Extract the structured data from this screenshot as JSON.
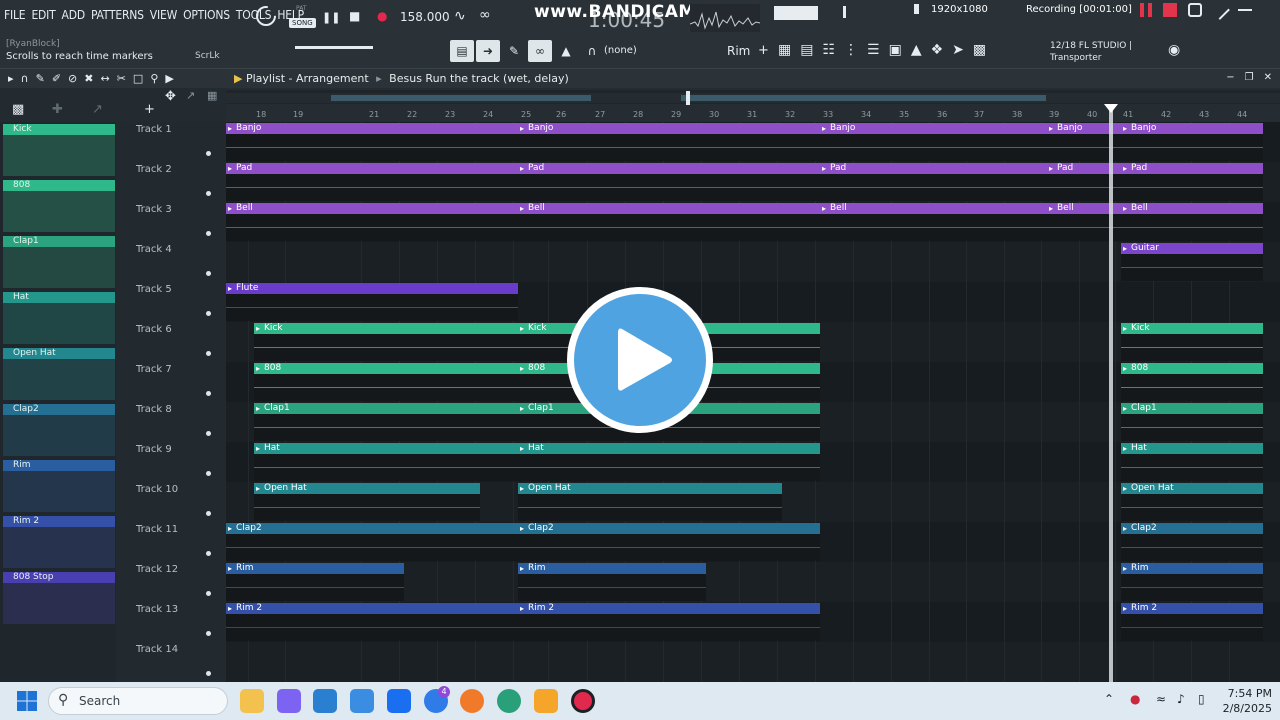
{
  "menu": [
    "FILE",
    "EDIT",
    "ADD",
    "PATTERNS",
    "VIEW",
    "OPTIONS",
    "TOOLS",
    "HELP"
  ],
  "hint": {
    "user": "[RyanBlock]",
    "text": "Scrolls to reach time markers",
    "scrlk": "ScrLk"
  },
  "transport": {
    "pat": "PAT",
    "song": "SONG",
    "tempo": "158.000",
    "time": "1:00:45"
  },
  "recorder": {
    "watermark": "www.BANDICAM.com",
    "resolution": "1920x1080",
    "status": "Recording [00:01:00]"
  },
  "toolbar": {
    "pattern_none": "(none)",
    "selected_channel": "Rim",
    "version_line1": "12/18  FL STUDIO |",
    "version_line2": "Transporter"
  },
  "playlist": {
    "title": "Playlist - Arrangement",
    "track_name": "Besus Run the track (wet, delay)"
  },
  "rack": [
    {
      "name": "Kick",
      "color": "#2fb98a"
    },
    {
      "name": "808",
      "color": "#2fb98a"
    },
    {
      "name": "Clap1",
      "color": "#2aa37e"
    },
    {
      "name": "Hat",
      "color": "#23978c"
    },
    {
      "name": "Open Hat",
      "color": "#23878f"
    },
    {
      "name": "Clap2",
      "color": "#246f92"
    },
    {
      "name": "Rim",
      "color": "#2a5ea0"
    },
    {
      "name": "Rim 2",
      "color": "#3550a8"
    },
    {
      "name": "808 Stop",
      "color": "#4a3fb0"
    }
  ],
  "tracks": [
    "Track 1",
    "Track 2",
    "Track 3",
    "Track 4",
    "Track 5",
    "Track 6",
    "Track 7",
    "Track 8",
    "Track 9",
    "Track 10",
    "Track 11",
    "Track 12",
    "Track 13",
    "Track 14"
  ],
  "bar_numbers": [
    "18",
    "19",
    "21",
    "22",
    "23",
    "24",
    "25",
    "26",
    "27",
    "28",
    "29",
    "30",
    "31",
    "32",
    "33",
    "34",
    "35",
    "36",
    "37",
    "38",
    "39",
    "40",
    "41",
    "42",
    "43",
    "44"
  ],
  "clips": [
    {
      "track": 0,
      "label": "Banjo",
      "color": "#8e4fc9",
      "starts": [
        0,
        292,
        594,
        821,
        895
      ]
    },
    {
      "track": 1,
      "label": "Pad",
      "color": "#8e4fc9",
      "starts": [
        0,
        292,
        594,
        821,
        895
      ]
    },
    {
      "track": 2,
      "label": "Bell",
      "color": "#8e4fc9",
      "starts": [
        0,
        292,
        594,
        821,
        895
      ]
    },
    {
      "track": 3,
      "label": "Guitar",
      "color": "#7b45cc",
      "starts": [
        895
      ]
    },
    {
      "track": 4,
      "label": "Flute",
      "color": "#6a3ccc",
      "starts": [
        0
      ]
    },
    {
      "track": 5,
      "label": "Kick",
      "color": "#2fb98a",
      "starts": [
        28,
        292,
        895
      ]
    },
    {
      "track": 6,
      "label": "808",
      "color": "#2fb98a",
      "starts": [
        28,
        292,
        895
      ]
    },
    {
      "track": 7,
      "label": "Clap1",
      "color": "#2aa37e",
      "starts": [
        28,
        292,
        895
      ]
    },
    {
      "track": 8,
      "label": "Hat",
      "color": "#23978c",
      "starts": [
        28,
        292,
        895
      ]
    },
    {
      "track": 9,
      "label": "Open Hat",
      "color": "#23878f",
      "starts": [
        28,
        292,
        895
      ]
    },
    {
      "track": 10,
      "label": "Clap2",
      "color": "#246f92",
      "starts": [
        0,
        292,
        895
      ]
    },
    {
      "track": 11,
      "label": "Rim",
      "color": "#2a5ea0",
      "starts": [
        0,
        292,
        895
      ]
    },
    {
      "track": 12,
      "label": "Rim 2",
      "color": "#3550a8",
      "starts": [
        0,
        292,
        895
      ]
    }
  ],
  "taskbar": {
    "search": "Search",
    "time": "7:54 PM",
    "date": "2/8/2025",
    "badge": "4"
  }
}
